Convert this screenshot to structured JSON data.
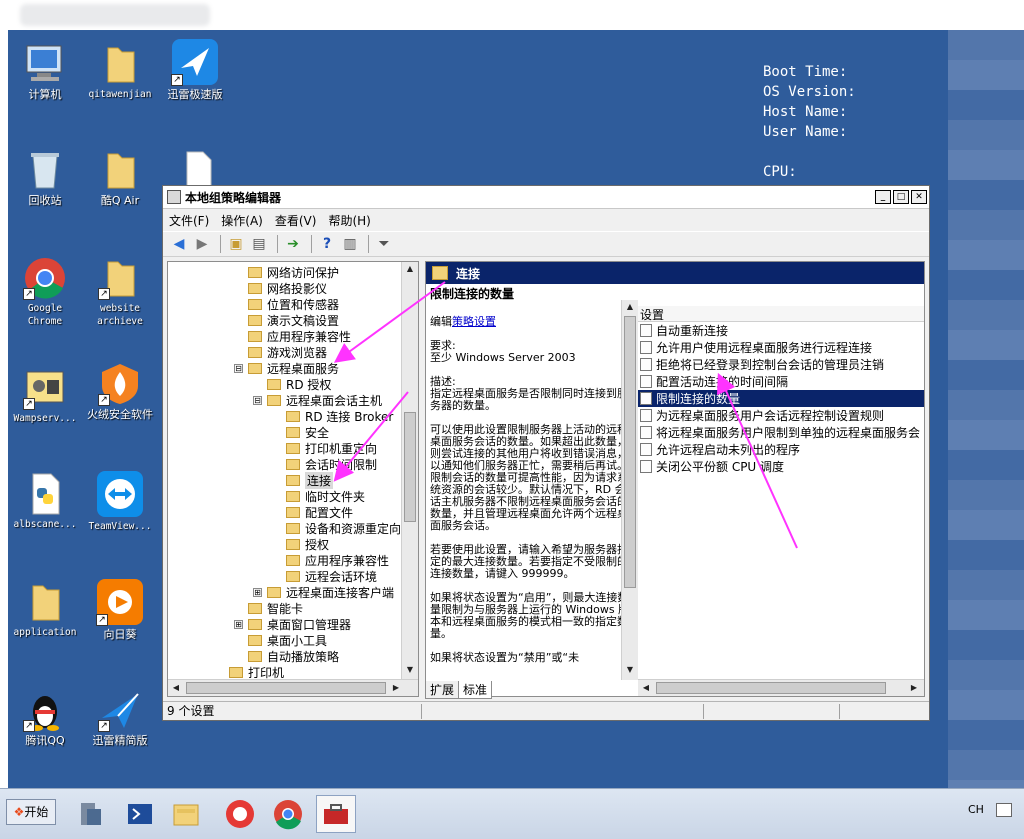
{
  "desktop": {
    "icons": [
      {
        "label": "计算机"
      },
      {
        "label": "qitawenjian"
      },
      {
        "label": "迅雷极速版"
      },
      {
        "label": "回收站"
      },
      {
        "label": "酷Q Air"
      },
      {
        "label": "Google Chrome"
      },
      {
        "label": "website archieve"
      },
      {
        "label": "Wampserv..."
      },
      {
        "label": "火绒安全软件"
      },
      {
        "label": "albscane..."
      },
      {
        "label": "TeamView..."
      },
      {
        "label": "application"
      },
      {
        "label": "向日葵"
      },
      {
        "label": "腾讯QQ"
      },
      {
        "label": "迅雷精简版"
      }
    ]
  },
  "bginfo": {
    "boot_time": "Boot Time:",
    "os_version": "OS Version:",
    "host_name": "Host Name:",
    "user_name": "User Name:",
    "cpu": "CPU:"
  },
  "window": {
    "title": "本地组策略编辑器",
    "menu": [
      "文件(F)",
      "操作(A)",
      "查看(V)",
      "帮助(H)"
    ],
    "tree": [
      {
        "label": "网络访问保护"
      },
      {
        "label": "网络投影仪"
      },
      {
        "label": "位置和传感器"
      },
      {
        "label": "演示文稿设置"
      },
      {
        "label": "应用程序兼容性"
      },
      {
        "label": "游戏浏览器"
      },
      {
        "label": "远程桌面服务",
        "expander": "⊟"
      },
      {
        "label": "RD 授权"
      },
      {
        "label": "远程桌面会话主机",
        "expander": "⊟"
      },
      {
        "label": "RD 连接 Broker"
      },
      {
        "label": "安全"
      },
      {
        "label": "打印机重定向"
      },
      {
        "label": "会话时间限制"
      },
      {
        "label": "连接"
      },
      {
        "label": "临时文件夹"
      },
      {
        "label": "配置文件"
      },
      {
        "label": "设备和资源重定向"
      },
      {
        "label": "授权"
      },
      {
        "label": "应用程序兼容性"
      },
      {
        "label": "远程会话环境"
      },
      {
        "label": "远程桌面连接客户端",
        "expander": "⊞"
      },
      {
        "label": "智能卡"
      },
      {
        "label": "桌面窗口管理器",
        "expander": "⊞"
      },
      {
        "label": "桌面小工具"
      },
      {
        "label": "自动播放策略"
      },
      {
        "label": "打印机"
      }
    ],
    "header_title": "连接",
    "description": {
      "title": "限制连接的数量",
      "edit_prefix": "编辑",
      "edit_link": "策略设置",
      "requirements_label": "要求:",
      "requirements": "至少 Windows Server 2003",
      "desc_label": "描述:",
      "desc": "指定远程桌面服务是否限制同时连接到服务器的数量。",
      "p1": "可以使用此设置限制服务器上活动的远程桌面服务会话的数量。如果超出此数量，则尝试连接的其他用户将收到错误消息，以通知他们服务器正忙，需要稍后再试。限制会话的数量可提高性能，因为请求系统资源的会话较少。默认情况下，RD 会话主机服务器不限制远程桌面服务会话的数量，并且管理远程桌面允许两个远程桌面服务会话。",
      "p2": "若要使用此设置，请输入希望为服务器指定的最大连接数量。若要指定不受限制的连接数量，请键入 999999。",
      "p3": "如果将状态设置为“启用”，则最大连接数量限制为与服务器上运行的 Windows 版本和远程桌面服务的模式相一致的指定数量。",
      "p4": "如果将状态设置为“禁用”或“未"
    },
    "list_header": "设置",
    "settings": [
      {
        "label": "自动重新连接"
      },
      {
        "label": "允许用户使用远程桌面服务进行远程连接"
      },
      {
        "label": "拒绝将已经登录到控制台会话的管理员注销"
      },
      {
        "label": "配置活动连接的时间间隔"
      },
      {
        "label": "限制连接的数量"
      },
      {
        "label": "为远程桌面服务用户会话远程控制设置规则"
      },
      {
        "label": "将远程桌面服务用户限制到单独的远程桌面服务会"
      },
      {
        "label": "允许远程启动未列出的程序"
      },
      {
        "label": "关闭公平份额 CPU 调度"
      }
    ],
    "tabs": [
      "扩展",
      "标准"
    ],
    "status": "9 个设置"
  },
  "taskbar": {
    "start_label": "开始",
    "tray_lang": "CH"
  }
}
